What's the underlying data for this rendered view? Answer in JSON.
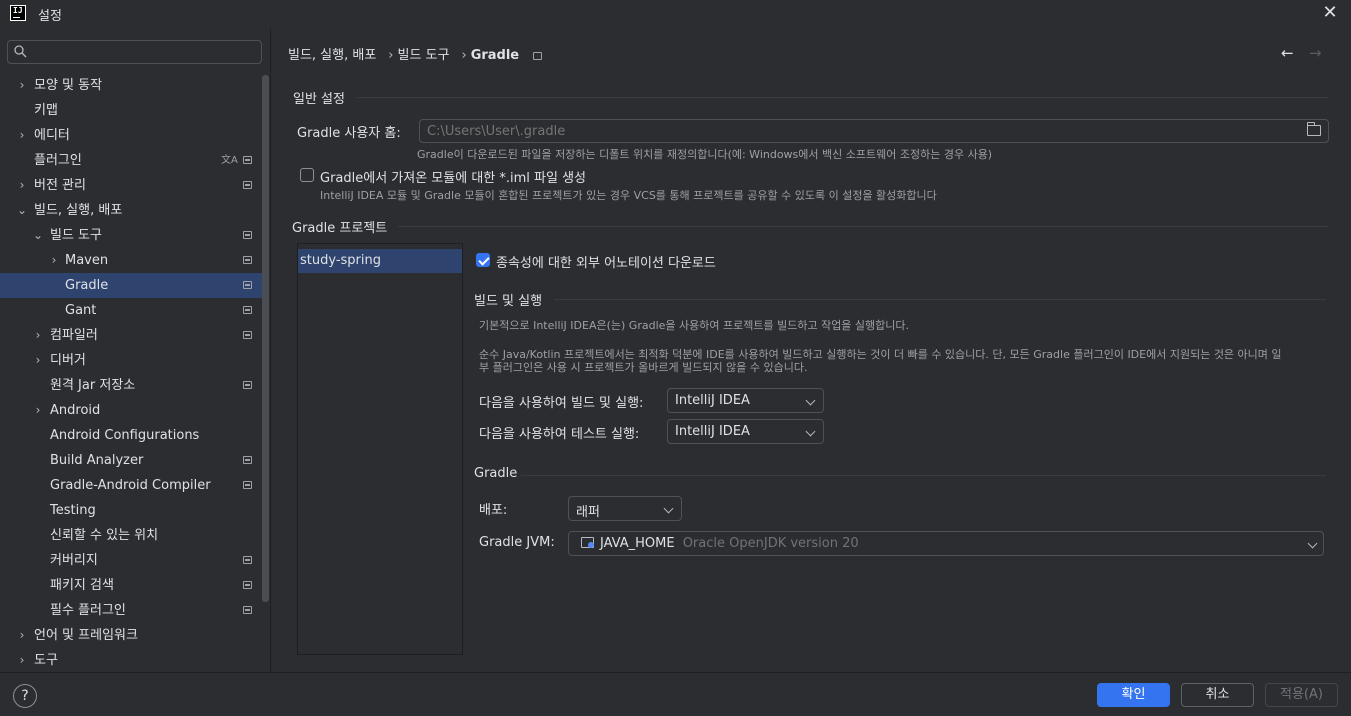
{
  "window": {
    "title": "설정",
    "app_icon_text": "IJ"
  },
  "search": {
    "placeholder": "",
    "value": ""
  },
  "sidebar": {
    "items": [
      {
        "label": "모양 및 동작",
        "level": 0,
        "arrow": "›",
        "badge": false
      },
      {
        "label": "키맵",
        "level": 0,
        "arrow": "",
        "badge": false
      },
      {
        "label": "에디터",
        "level": 0,
        "arrow": "›",
        "badge": false
      },
      {
        "label": "플러그인",
        "level": 0,
        "arrow": "",
        "badge": true,
        "translate": true
      },
      {
        "label": "버전 관리",
        "level": 0,
        "arrow": "›",
        "badge": true
      },
      {
        "label": "빌드, 실행, 배포",
        "level": 0,
        "arrow": "⌄",
        "badge": false
      },
      {
        "label": "빌드 도구",
        "level": 1,
        "arrow": "⌄",
        "badge": true
      },
      {
        "label": "Maven",
        "level": 2,
        "arrow": "›",
        "badge": true
      },
      {
        "label": "Gradle",
        "level": 2,
        "arrow": "",
        "badge": true,
        "selected": true
      },
      {
        "label": "Gant",
        "level": 2,
        "arrow": "",
        "badge": true
      },
      {
        "label": "컴파일러",
        "level": 1,
        "arrow": "›",
        "badge": true
      },
      {
        "label": "디버거",
        "level": 1,
        "arrow": "›",
        "badge": false
      },
      {
        "label": "원격 Jar 저장소",
        "level": 1,
        "arrow": "",
        "badge": true
      },
      {
        "label": "Android",
        "level": 1,
        "arrow": "›",
        "badge": false
      },
      {
        "label": "Android Configurations",
        "level": 1,
        "arrow": "",
        "badge": false
      },
      {
        "label": "Build Analyzer",
        "level": 1,
        "arrow": "",
        "badge": true
      },
      {
        "label": "Gradle-Android Compiler",
        "level": 1,
        "arrow": "",
        "badge": true
      },
      {
        "label": "Testing",
        "level": 1,
        "arrow": "",
        "badge": false
      },
      {
        "label": "신뢰할 수 있는 위치",
        "level": 1,
        "arrow": "",
        "badge": false
      },
      {
        "label": "커버리지",
        "level": 1,
        "arrow": "",
        "badge": true
      },
      {
        "label": "패키지 검색",
        "level": 1,
        "arrow": "",
        "badge": true
      },
      {
        "label": "필수 플러그인",
        "level": 1,
        "arrow": "",
        "badge": true
      },
      {
        "label": "언어 및 프레임워크",
        "level": 0,
        "arrow": "›",
        "badge": false
      },
      {
        "label": "도구",
        "level": 0,
        "arrow": "›",
        "badge": false
      }
    ]
  },
  "breadcrumb": {
    "part1": "빌드, 실행, 배포",
    "sep": "›",
    "part2": "빌드 도구",
    "current": "Gradle"
  },
  "nav": {
    "back": "←",
    "forward": "→"
  },
  "general": {
    "title": "일반 설정",
    "user_home_label": "Gradle 사용자 홈:",
    "user_home_placeholder": "C:\\Users\\User\\.gradle",
    "user_home_hint": "Gradle이 다운로드된 파일을 저장하는 디폴트 위치를 재정의합니다(예: Windows에서 백신 소프트웨어 조정하는 경우 사용)",
    "iml_checkbox_label": "Gradle에서 가져온 모듈에 대한 *.iml 파일 생성",
    "iml_checkbox_hint": "IntelliJ IDEA 모듈 및 Gradle 모듈이 혼합된 프로젝트가 있는 경우 VCS를 통해 프로젝트를 공유할 수 있도록 이 설정을 활성화합니다"
  },
  "projects": {
    "title": "Gradle 프로젝트",
    "items": [
      "study-spring"
    ],
    "download_annotations_label": "종속성에 대한 외부 어노테이션 다운로드",
    "build_run": {
      "title": "빌드 및 실행",
      "desc1": "기본적으로 IntelliJ IDEA은(는) Gradle을 사용하여 프로젝트를 빌드하고 작업을 실행합니다.",
      "desc2a": "순수 Java/Kotlin 프로젝트에서는 최적화 덕분에 IDE를 사용하여 빌드하고 실행하는 것이 더 빠를 수 있습니다. 단, 모든 Gradle 플러그인이 IDE에서 지원되는 것은 아니며 일",
      "desc2b": "부 플러그인은 사용 시 프로젝트가 올바르게 빌드되지 않을 수 있습니다.",
      "build_using_label": "다음을 사용하여 빌드 및 실행:",
      "build_using_value": "IntelliJ IDEA",
      "test_using_label": "다음을 사용하여 테스트 실행:",
      "test_using_value": "IntelliJ IDEA"
    },
    "gradle": {
      "title": "Gradle",
      "distribution_label": "배포:",
      "distribution_value": "래퍼",
      "jvm_label": "Gradle JVM:",
      "jvm_value": "JAVA_HOME",
      "jvm_detail": "Oracle OpenJDK version 20"
    }
  },
  "footer": {
    "help": "?",
    "ok": "확인",
    "cancel": "취소",
    "apply": "적용(A)"
  },
  "colors": {
    "accent": "#3574f0",
    "selection": "#2e436e",
    "background": "#2b2d30"
  }
}
